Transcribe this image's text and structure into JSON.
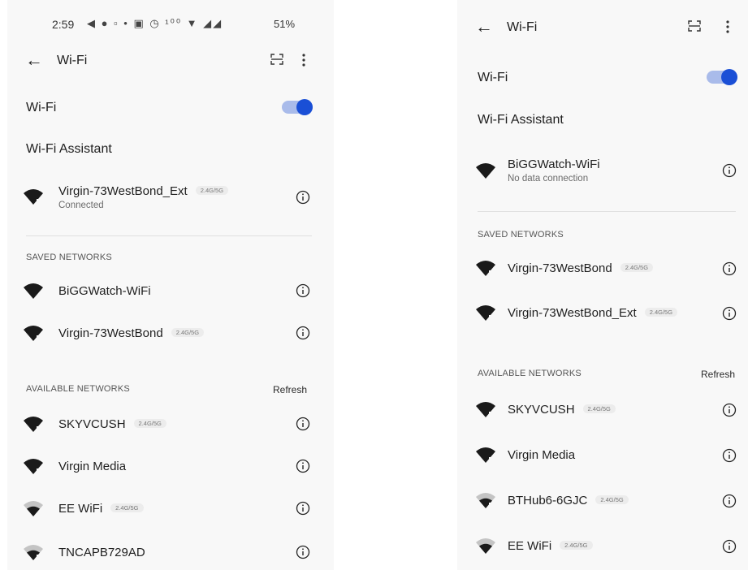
{
  "status_bar": {
    "time": "2:59",
    "icons": "◀ ● ▫ •  ▣ ◷ ¹⁰⁰ ▼ ◢◢",
    "battery": "51%"
  },
  "left": {
    "title": "Wi-Fi",
    "wifi_toggle_label": "Wi-Fi",
    "wifi_on": true,
    "assistant_label": "Wi-Fi Assistant",
    "connected": {
      "name": "Virgin-73WestBond_Ext",
      "badge": "2.4G/5G",
      "status": "Connected",
      "icon": "wifi-full-icon"
    },
    "saved_header": "SAVED NETWORKS",
    "saved": [
      {
        "name": "BiGGWatch-WiFi",
        "badge": "",
        "icon": "wifi-full-icon"
      },
      {
        "name": "Virgin-73WestBond",
        "badge": "2.4G/5G",
        "icon": "wifi-full-icon"
      }
    ],
    "available_header": "AVAILABLE NETWORKS",
    "refresh_label": "Refresh",
    "available": [
      {
        "name": "SKYVCUSH",
        "badge": "2.4G/5G",
        "icon": "wifi-full-icon"
      },
      {
        "name": "Virgin Media",
        "badge": "",
        "icon": "wifi-full-icon"
      },
      {
        "name": "EE WiFi",
        "badge": "2.4G/5G",
        "icon": "wifi-weak-icon"
      },
      {
        "name": "TNCAPB729AD",
        "badge": "",
        "icon": "wifi-weak-icon"
      }
    ]
  },
  "right": {
    "title": "Wi-Fi",
    "wifi_toggle_label": "Wi-Fi",
    "wifi_on": true,
    "assistant_label": "Wi-Fi Assistant",
    "connected": {
      "name": "BiGGWatch-WiFi",
      "badge": "",
      "status": "No data connection",
      "icon": "wifi-full-icon"
    },
    "saved_header": "SAVED NETWORKS",
    "saved": [
      {
        "name": "Virgin-73WestBond",
        "badge": "2.4G/5G",
        "icon": "wifi-full-icon"
      },
      {
        "name": "Virgin-73WestBond_Ext",
        "badge": "2.4G/5G",
        "icon": "wifi-full-icon"
      }
    ],
    "available_header": "AVAILABLE NETWORKS",
    "refresh_label": "Refresh",
    "available": [
      {
        "name": "SKYVCUSH",
        "badge": "2.4G/5G",
        "icon": "wifi-full-icon"
      },
      {
        "name": "Virgin Media",
        "badge": "",
        "icon": "wifi-full-icon"
      },
      {
        "name": "BTHub6-6GJC",
        "badge": "2.4G/5G",
        "icon": "wifi-weak-icon"
      },
      {
        "name": "EE WiFi",
        "badge": "2.4G/5G",
        "icon": "wifi-weak-icon"
      }
    ]
  },
  "colors": {
    "accent": "#1a4fd6",
    "toggle_track": "#a9bbea",
    "background": "#f8f8f8"
  }
}
